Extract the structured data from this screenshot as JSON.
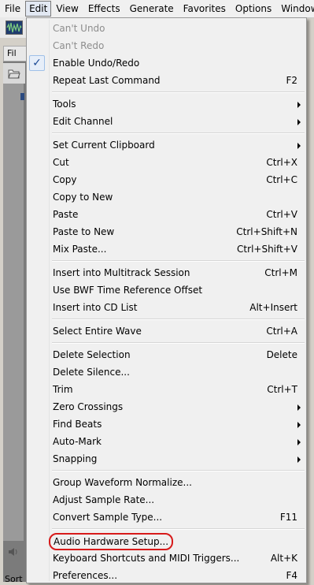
{
  "menubar": {
    "items": [
      {
        "label": "File"
      },
      {
        "label": "Edit"
      },
      {
        "label": "View"
      },
      {
        "label": "Effects"
      },
      {
        "label": "Generate"
      },
      {
        "label": "Favorites"
      },
      {
        "label": "Options"
      },
      {
        "label": "Window"
      }
    ],
    "active": "Edit"
  },
  "panel": {
    "tab_label": "Fil",
    "sort_label": "Sort"
  },
  "edit_menu": {
    "items": {
      "cant_undo": {
        "label": "Can't Undo",
        "shortcut": ""
      },
      "cant_redo": {
        "label": "Can't Redo",
        "shortcut": ""
      },
      "enable_undo_redo": {
        "label": "Enable Undo/Redo",
        "checked": true
      },
      "repeat_last_command": {
        "label": "Repeat Last Command",
        "shortcut": "F2"
      },
      "tools": {
        "label": "Tools"
      },
      "edit_channel": {
        "label": "Edit Channel"
      },
      "set_current_clipboard": {
        "label": "Set Current Clipboard"
      },
      "cut": {
        "label": "Cut",
        "shortcut": "Ctrl+X"
      },
      "copy": {
        "label": "Copy",
        "shortcut": "Ctrl+C"
      },
      "copy_to_new": {
        "label": "Copy to New"
      },
      "paste": {
        "label": "Paste",
        "shortcut": "Ctrl+V"
      },
      "paste_to_new": {
        "label": "Paste to New",
        "shortcut": "Ctrl+Shift+N"
      },
      "mix_paste": {
        "label": "Mix Paste...",
        "shortcut": "Ctrl+Shift+V"
      },
      "insert_multitrack": {
        "label": "Insert into Multitrack Session",
        "shortcut": "Ctrl+M"
      },
      "use_bwf": {
        "label": "Use BWF Time Reference Offset"
      },
      "insert_cd_list": {
        "label": "Insert into CD List",
        "shortcut": "Alt+Insert"
      },
      "select_entire_wave": {
        "label": "Select Entire Wave",
        "shortcut": "Ctrl+A"
      },
      "delete_selection": {
        "label": "Delete Selection",
        "shortcut": "Delete"
      },
      "delete_silence": {
        "label": "Delete Silence..."
      },
      "trim": {
        "label": "Trim",
        "shortcut": "Ctrl+T"
      },
      "zero_crossings": {
        "label": "Zero Crossings"
      },
      "find_beats": {
        "label": "Find Beats"
      },
      "auto_mark": {
        "label": "Auto-Mark"
      },
      "snapping": {
        "label": "Snapping"
      },
      "group_normalize": {
        "label": "Group Waveform Normalize..."
      },
      "adjust_sample_rate": {
        "label": "Adjust Sample Rate..."
      },
      "convert_sample_type": {
        "label": "Convert Sample Type...",
        "shortcut": "F11"
      },
      "audio_hardware_setup": {
        "label": "Audio Hardware Setup...",
        "highlighted": true
      },
      "keyboard_shortcuts": {
        "label": "Keyboard Shortcuts and MIDI Triggers...",
        "shortcut": "Alt+K"
      },
      "preferences": {
        "label": "Preferences...",
        "shortcut": "F4"
      }
    }
  },
  "colors": {
    "highlight_ring": "#d71a1a",
    "check_mark": "#1c4a95",
    "disabled_text": "#8d8d8d"
  }
}
